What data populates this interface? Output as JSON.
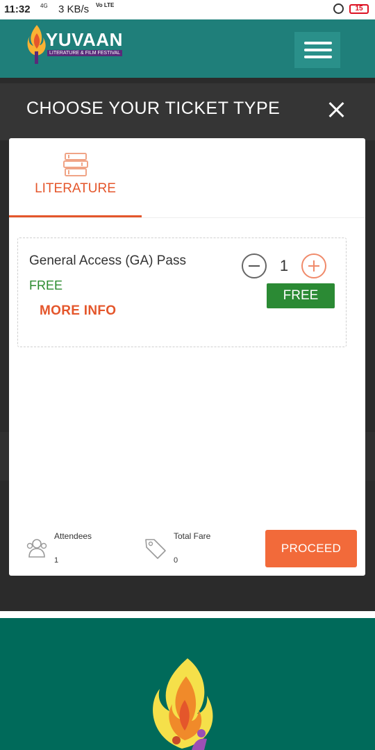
{
  "status_bar": {
    "time": "11:32",
    "network": "4G",
    "speed": "3 KB/s",
    "volte": "Vo LTE",
    "battery": "15"
  },
  "header": {
    "brand_name": "YUVAAN",
    "brand_tagline": "LITERATURE & FILM FESTIVAL",
    "menu_icon": "hamburger-icon",
    "colors": {
      "teal": "#1f7f7a",
      "accent": "#e4562b"
    }
  },
  "modal": {
    "title": "CHOOSE YOUR TICKET TYPE",
    "close_icon": "close-icon",
    "tabs": [
      {
        "label": "LITERATURE",
        "icon": "books-icon",
        "active": true
      }
    ],
    "ticket": {
      "name": "General Access (GA) Pass",
      "price": "FREE",
      "more_info": "MORE INFO",
      "quantity": "1",
      "badge": "FREE"
    },
    "footer": {
      "attendees_label": "Attendees",
      "attendees_value": "1",
      "fare_label": "Total Fare",
      "fare_value": "0",
      "proceed_label": "PROCEED"
    }
  }
}
